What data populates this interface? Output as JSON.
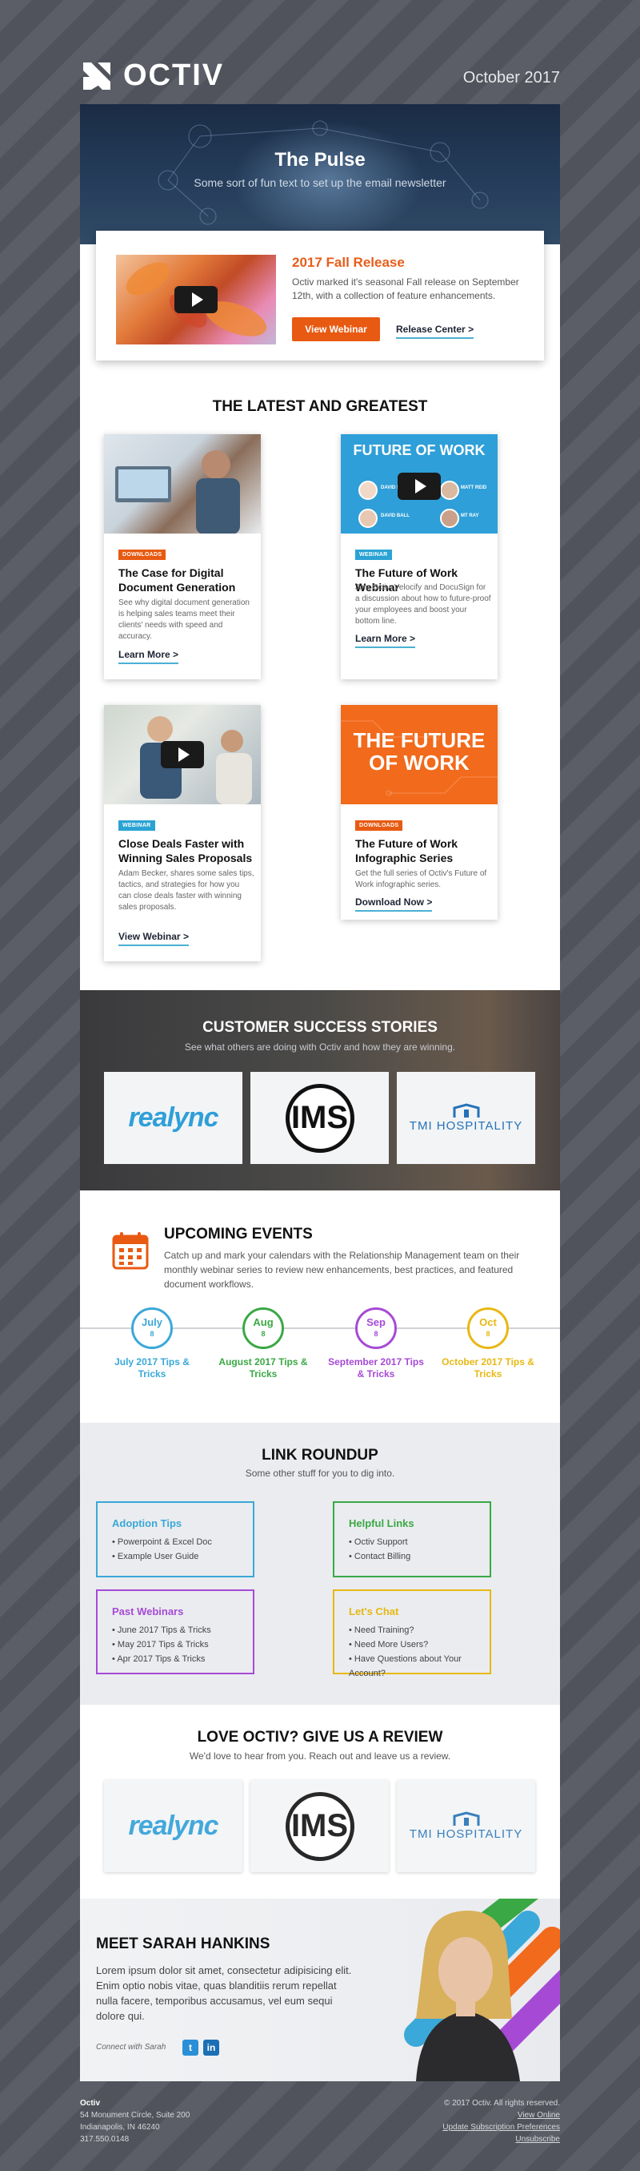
{
  "header": {
    "brand": "OCTIV",
    "date": "October 2017"
  },
  "hero": {
    "title": "The Pulse",
    "subtitle": "Some sort of fun text to set up the email newsletter"
  },
  "feature": {
    "title": "2017 Fall Release",
    "description": "Octiv marked it's seasonal Fall release on September 12th, with a collection of feature enhancements.",
    "primary_button": "View Webinar",
    "secondary_link": "Release Center"
  },
  "latest": {
    "title": "THE LATEST AND GREATEST",
    "items": [
      {
        "tag": "DOWNLOADS",
        "title": "The Case for Digital Document Generation",
        "description": "See why digital document generation is helping sales teams meet their clients' needs with speed and accuracy.",
        "link": "Learn More"
      },
      {
        "tag": "WEBINAR",
        "title": "The Future of Work Webinar",
        "description": "Join Octiv, Velocify and DocuSign for a discussion about how to future-proof your employees and boost your bottom line.",
        "link": "Learn More",
        "image_heading": "FUTURE OF WORK",
        "speakers": [
          "DAVID SEIFERT",
          "MATT REID",
          "DAVID BALL",
          "MT RAY"
        ]
      },
      {
        "tag": "WEBINAR",
        "title": "Close Deals Faster with Winning Sales Proposals",
        "description": "Adam Becker, shares some sales tips, tactics, and strategies for how you can close deals faster with winning sales proposals.",
        "link": "View Webinar"
      },
      {
        "tag": "DOWNLOADS",
        "title": "The Future of Work Infographic Series",
        "description": "Get the full series of Octiv's Future of Work infographic series.",
        "link": "Download Now",
        "image_heading": "THE FUTURE OF WORK"
      }
    ]
  },
  "success": {
    "title": "CUSTOMER SUCCESS STORIES",
    "subtitle": "See what others are doing with Octiv and how they are winning.",
    "logos": [
      "realync",
      "IMS",
      "TMI HOSPITALITY"
    ]
  },
  "events": {
    "title": "UPCOMING EVENTS",
    "description": "Catch up and mark your calendars with the Relationship Management team on their monthly webinar series to review new enhancements, best practices, and featured document workflows.",
    "items": [
      {
        "month": "July",
        "day": "8",
        "label": "July 2017 Tips & Tricks",
        "color": "#3aa8d8"
      },
      {
        "month": "Aug",
        "day": "8",
        "label": "August 2017 Tips & Tricks",
        "color": "#3aa845"
      },
      {
        "month": "Sep",
        "day": "8",
        "label": "September 2017 Tips & Tricks",
        "color": "#a64ad6"
      },
      {
        "month": "Oct",
        "day": "8",
        "label": "October 2017 Tips & Tricks",
        "color": "#e8b814"
      }
    ]
  },
  "roundup": {
    "title": "LINK ROUNDUP",
    "subtitle": "Some other stuff for you to dig into.",
    "boxes": [
      {
        "title": "Adoption Tips",
        "color": "#3aa8d8",
        "links": [
          "Powerpoint & Excel Doc",
          "Example User Guide"
        ]
      },
      {
        "title": "Helpful Links",
        "color": "#3aa845",
        "links": [
          "Octiv Support",
          "Contact Billing"
        ]
      },
      {
        "title": "Past Webinars",
        "color": "#a64ad6",
        "links": [
          "June 2017 Tips & Tricks",
          "May 2017 Tips & Tricks",
          "Apr 2017 Tips & Tricks"
        ]
      },
      {
        "title": "Let's Chat",
        "color": "#e8b814",
        "links": [
          "Need Training?",
          "Need More Users?",
          "Have Questions about Your Account?"
        ]
      }
    ]
  },
  "review": {
    "title": "LOVE OCTIV? GIVE US A REVIEW",
    "subtitle": "We'd love to hear from you. Reach out and leave us a review.",
    "logos": [
      "realync",
      "IMS",
      "TMI HOSPITALITY"
    ]
  },
  "meet": {
    "title": "MEET SARAH HANKINS",
    "text": "Lorem ipsum dolor sit amet, consectetur adipisicing elit. Enim optio nobis vitae, quas blanditiis rerum repellat nulla facere, temporibus accusamus, vel eum sequi dolore qui.",
    "connect": "Connect with Sarah",
    "twitter": "t",
    "linkedin": "in"
  },
  "footer": {
    "company": "Octiv",
    "address1": "54 Monument Circle, Suite 200",
    "address2": "Indianapolis, IN 46240",
    "phone": "317.550.0148",
    "copyright": "© 2017 Octiv. All rights reserved.",
    "view_online": "View Online",
    "preferences": "Update Subscription Preferences",
    "unsubscribe": "Unsubscribe"
  },
  "colors": {
    "orange": "#e85a12",
    "blue": "#2aa3d4",
    "background": "#575a63"
  }
}
